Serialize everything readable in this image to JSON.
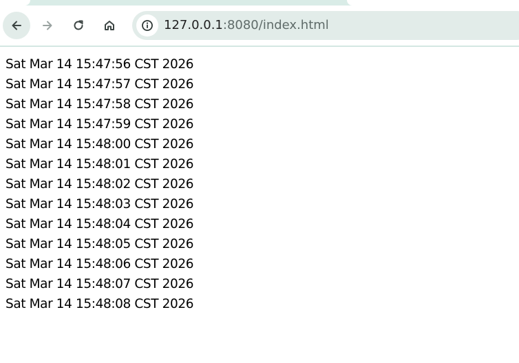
{
  "browser": {
    "url_host": "127.0.0.1",
    "url_path": ":8080/index.html",
    "icons": {
      "back": "arrow-left-icon",
      "forward": "arrow-right-icon",
      "reload": "reload-icon",
      "home": "home-icon",
      "site_info": "info-icon"
    },
    "colors": {
      "chrome_tint": "#d9ece7",
      "omnibox": "#e2ece9"
    }
  },
  "page": {
    "lines": [
      "Sat Mar 14 15:47:56 CST 2026",
      "Sat Mar 14 15:47:57 CST 2026",
      "Sat Mar 14 15:47:58 CST 2026",
      "Sat Mar 14 15:47:59 CST 2026",
      "Sat Mar 14 15:48:00 CST 2026",
      "Sat Mar 14 15:48:01 CST 2026",
      "Sat Mar 14 15:48:02 CST 2026",
      "Sat Mar 14 15:48:03 CST 2026",
      "Sat Mar 14 15:48:04 CST 2026",
      "Sat Mar 14 15:48:05 CST 2026",
      "Sat Mar 14 15:48:06 CST 2026",
      "Sat Mar 14 15:48:07 CST 2026",
      "Sat Mar 14 15:48:08 CST 2026"
    ]
  }
}
